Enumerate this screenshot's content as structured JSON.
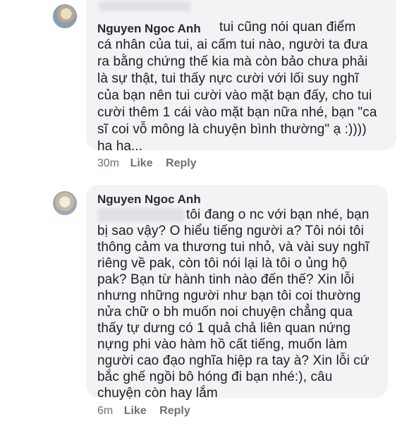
{
  "comments": [
    {
      "author": "Nguyen Ngoc Anh",
      "body_lines": [
        "tui cũng nói quan điểm",
        "cá nhân của tui, ai cấm tui nào, người ta đưa",
        "ra bằng chứng thế kia mà còn bảo chưa phải",
        "là sự thật, tui thấy nực cười với lối suy nghĩ",
        "của bạn nên tui cười vào mặt bạn đấy, cho tui",
        "cười thêm 1 cái vào mặt bạn nữa nhé, bạn \"ca",
        "sĩ  coi vỗ mông là chuyện bình thường\" ạ :))))",
        "ha ha..."
      ],
      "time": "30m",
      "like_label": "Like",
      "reply_label": "Reply"
    },
    {
      "author": "Nguyen Ngoc Anh",
      "body_lines": [
        "tôi đang o nc với bạn nhé, bạn",
        "bị sao vậy? O hiểu tiếng người a? Tôi nói tôi",
        "thông cảm va thương tui nhỏ, và vài suy nghĩ",
        "riêng về pak, còn tôi nói lại là tôi o ủng hộ",
        "pak? Bạn từ hành tinh nào đến thế? Xin lỗi",
        "nhưng những người như bạn tôi coi thường",
        "nửa chữ o bh muốn noi chuyện chẳng qua",
        "thấy tự dưng có 1 quả chả liên quan nứng",
        "nựng phi vào hàm hồ cất tiếng, muốn làm",
        "người cao đạo nghĩa hiệp ra tay à? Xin lỗi cứ",
        "bắc ghế ngồi bô hóng đi bạn nhé:), câu",
        "chuyện còn hay lắm"
      ],
      "time": "6m",
      "like_label": "Like",
      "reply_label": "Reply"
    }
  ]
}
